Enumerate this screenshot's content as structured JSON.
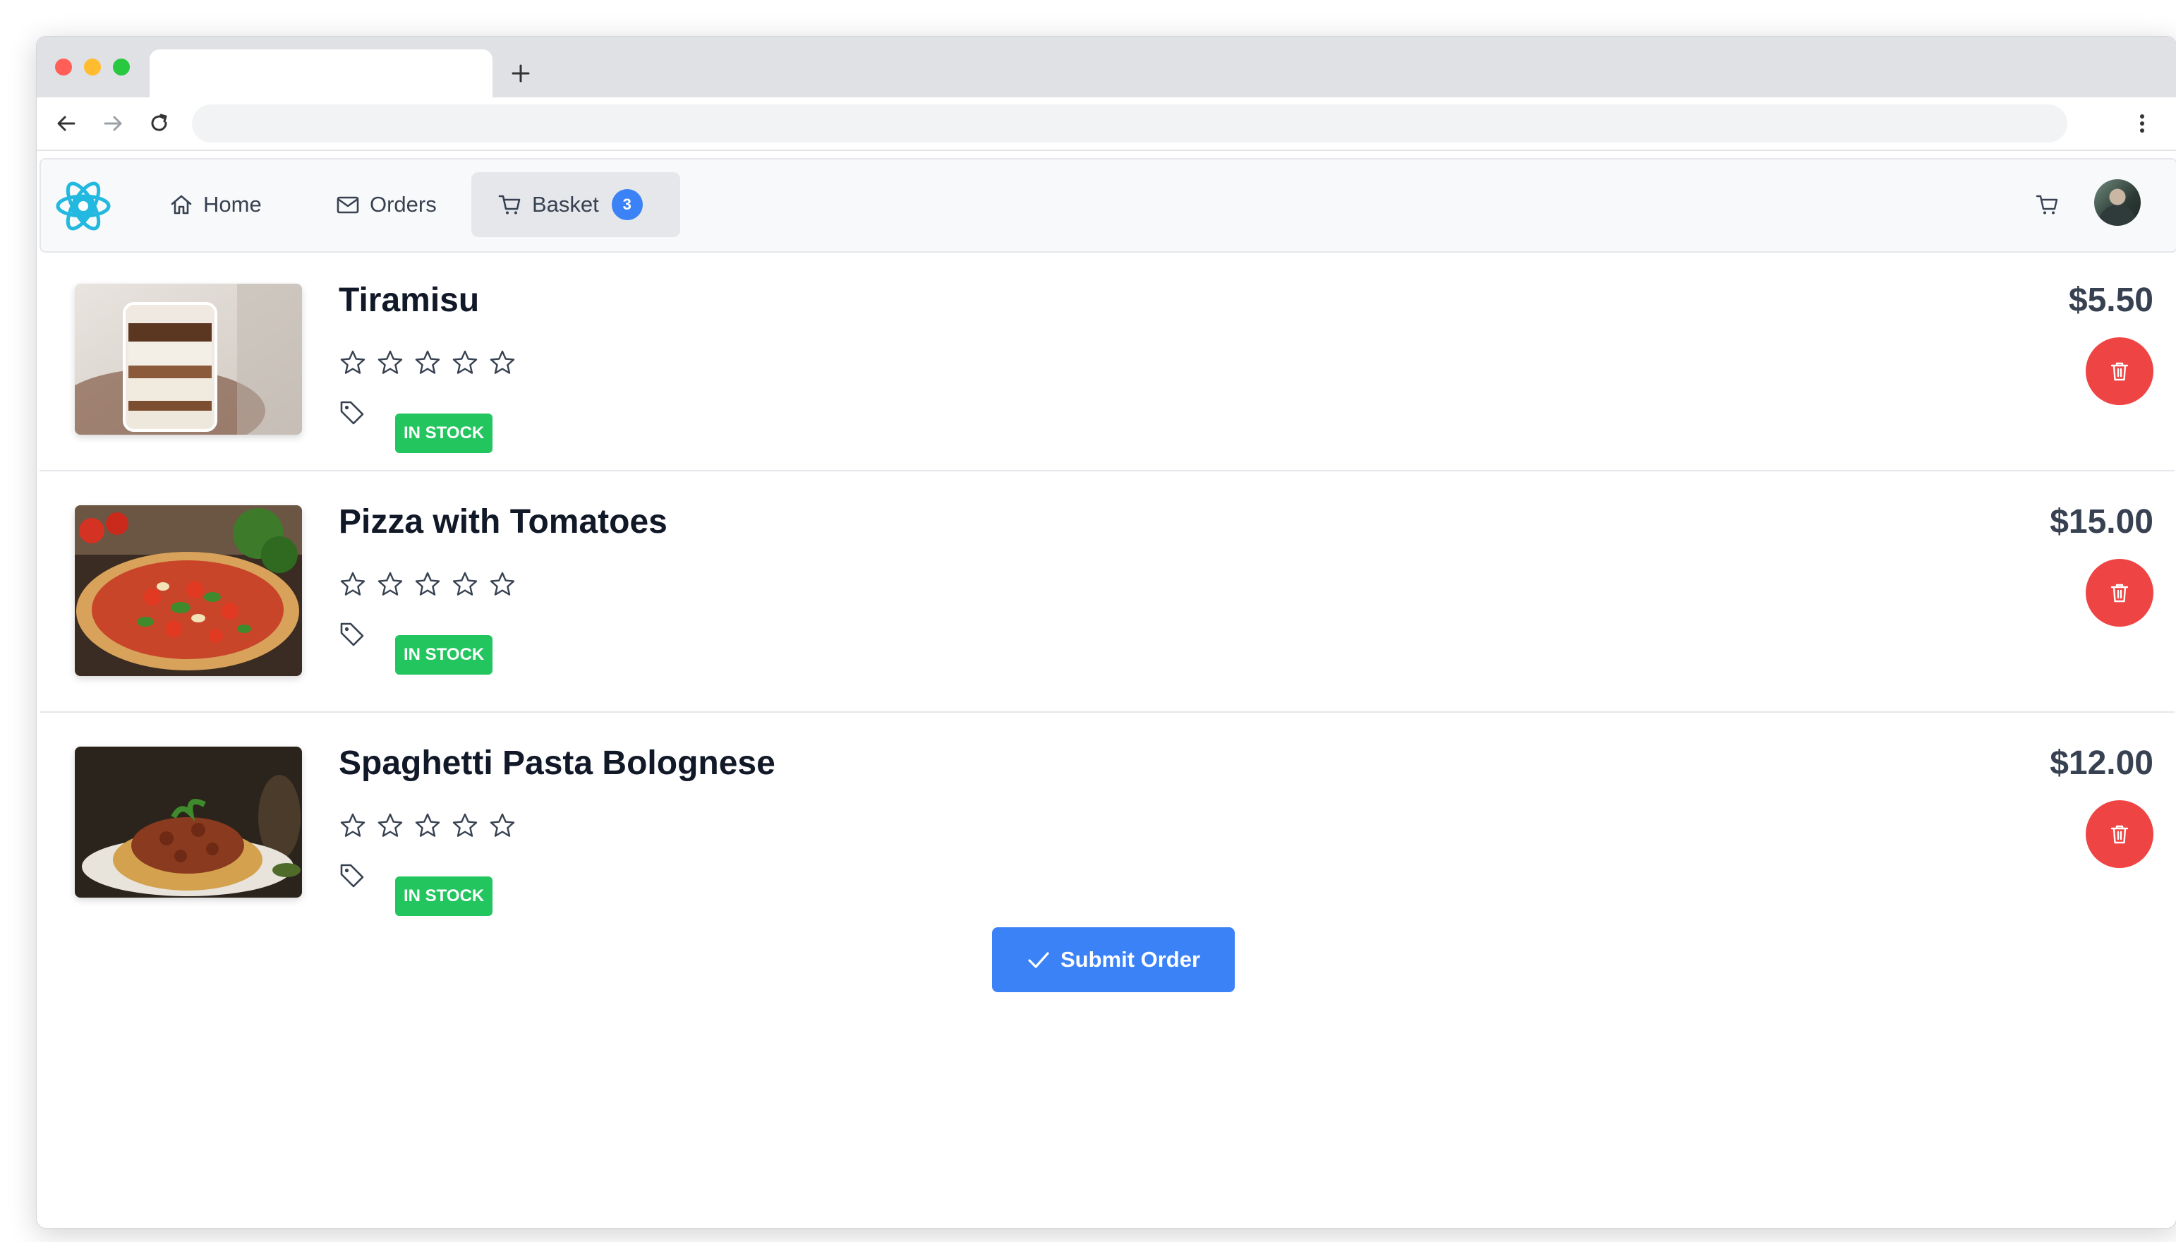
{
  "browser": {
    "tab_title": "",
    "address": "",
    "new_tab_label": "+"
  },
  "nav": {
    "home": "Home",
    "orders": "Orders",
    "basket": "Basket",
    "basket_count": "3"
  },
  "items": [
    {
      "name": "Tiramisu",
      "price": "$5.50",
      "rating": 0,
      "stock": "IN STOCK",
      "image": "tiramisu-dessert-photo"
    },
    {
      "name": "Pizza with Tomatoes",
      "price": "$15.00",
      "rating": 0,
      "stock": "IN STOCK",
      "image": "pizza-photo"
    },
    {
      "name": "Spaghetti Pasta Bolognese",
      "price": "$12.00",
      "rating": 0,
      "stock": "IN STOCK",
      "image": "spaghetti-bolognese-photo"
    }
  ],
  "actions": {
    "submit": "Submit Order"
  },
  "icons": {
    "home": "home-icon",
    "orders": "envelope-icon",
    "basket": "cart-icon",
    "tag": "tag-icon",
    "star": "star-outline-icon",
    "delete": "trash-icon",
    "submit": "check-icon"
  },
  "colors": {
    "accent": "#3b82f6",
    "danger": "#ef4444",
    "success": "#22c55e",
    "logo": "#22b8e0"
  }
}
